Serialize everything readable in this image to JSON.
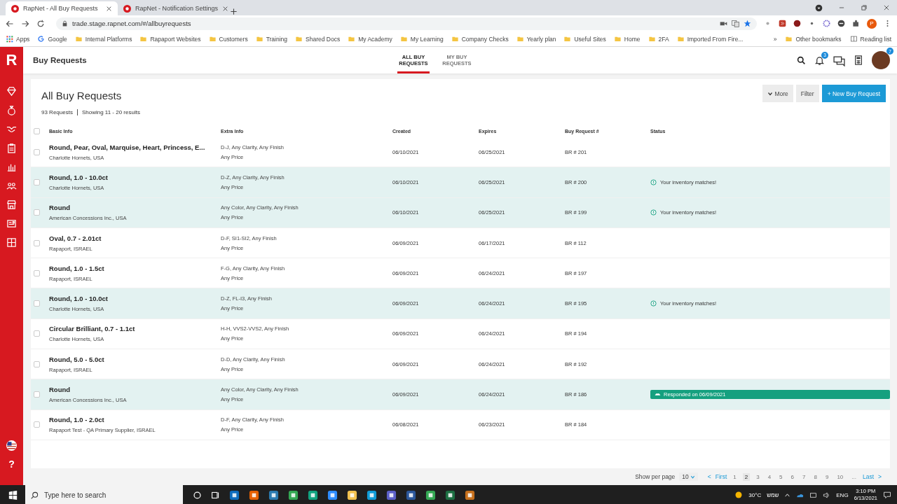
{
  "browser": {
    "tabs": [
      {
        "title": "RapNet - All Buy Requests",
        "selected": true
      },
      {
        "title": "RapNet - Notification Settings",
        "selected": false
      }
    ],
    "url": "trade.stage.rapnet.com/#/allbuyrequests",
    "profile": "P",
    "bookmarks": [
      {
        "kind": "apps",
        "label": "Apps"
      },
      {
        "kind": "google",
        "label": "Google"
      },
      {
        "kind": "folder",
        "label": "Internal Platforms"
      },
      {
        "kind": "folder",
        "label": "Rapaport Websites"
      },
      {
        "kind": "folder",
        "label": "Customers"
      },
      {
        "kind": "folder",
        "label": "Training"
      },
      {
        "kind": "folder",
        "label": "Shared Docs"
      },
      {
        "kind": "folder",
        "label": "My Academy"
      },
      {
        "kind": "folder",
        "label": "My Learning"
      },
      {
        "kind": "folder",
        "label": "Company Checks"
      },
      {
        "kind": "folder",
        "label": "Yearly plan"
      },
      {
        "kind": "folder",
        "label": "Useful Sites"
      },
      {
        "kind": "folder",
        "label": "Home"
      },
      {
        "kind": "folder",
        "label": "2FA"
      },
      {
        "kind": "folder",
        "label": "Imported From Fire..."
      }
    ],
    "overflow": "»",
    "other_bookmarks": "Other bookmarks",
    "reading_list": "Reading list"
  },
  "app": {
    "logo": "R",
    "title": "Buy Requests",
    "help": "?",
    "nav": [
      {
        "label": "ALL BUY REQUESTS",
        "selected": true
      },
      {
        "label": "MY BUY REQUESTS",
        "selected": false
      }
    ],
    "notification_count": "3",
    "avatar_badge": "7"
  },
  "page": {
    "title": "All Buy Requests",
    "count": "93 Requests",
    "showing": "Showing 11 - 20 results",
    "buttons": [
      {
        "kind": "menu",
        "label": "More"
      },
      {
        "kind": "plain",
        "label": "Filter"
      },
      {
        "kind": "primary",
        "label": "+ New Buy Request"
      }
    ]
  },
  "table": {
    "all_checked": false,
    "columns": [
      "Basic Info",
      "Extra Info",
      "Created",
      "Expires",
      "Buy Request #",
      "Status"
    ],
    "rows": [
      {
        "checked": false,
        "highlighted": false,
        "title": "Round, Pear, Oval, Marquise, Heart, Princess, E...",
        "company": "Charlotte Hornets, USA",
        "extra": "D-J, Any Clarity, Any Finish",
        "price": "Any Price",
        "created": "06/10/2021",
        "expires": "06/25/2021",
        "number": "BR # 201"
      },
      {
        "checked": false,
        "highlighted": true,
        "title": "Round, 1.0 - 10.0ct",
        "company": "Charlotte Hornets, USA",
        "extra": "D-Z, Any Clarity, Any Finish",
        "price": "Any Price",
        "created": "06/10/2021",
        "expires": "06/25/2021",
        "number": "BR # 200",
        "status": {
          "kind": "match",
          "text": "Your inventory matches!"
        }
      },
      {
        "checked": false,
        "highlighted": true,
        "title": "Round",
        "company": "American Concessions Inc., USA",
        "extra": "Any Color, Any Clarity, Any Finish",
        "price": "Any Price",
        "created": "06/10/2021",
        "expires": "06/25/2021",
        "number": "BR # 199",
        "status": {
          "kind": "match",
          "text": "Your inventory matches!"
        }
      },
      {
        "checked": false,
        "highlighted": false,
        "title": "Oval, 0.7 - 2.01ct",
        "company": "Rapaport, ISRAEL",
        "extra": "D-F, SI1-SI2, Any Finish",
        "price": "Any Price",
        "created": "06/09/2021",
        "expires": "06/17/2021",
        "number": "BR # 112"
      },
      {
        "checked": false,
        "highlighted": false,
        "title": "Round, 1.0 - 1.5ct",
        "company": "Rapaport, ISRAEL",
        "extra": "F-G, Any Clarity, Any Finish",
        "price": "Any Price",
        "created": "06/09/2021",
        "expires": "06/24/2021",
        "number": "BR # 197"
      },
      {
        "checked": false,
        "highlighted": true,
        "title": "Round, 1.0 - 10.0ct",
        "company": "Charlotte Hornets, USA",
        "extra": "D-Z, FL-I3, Any Finish",
        "price": "Any Price",
        "created": "06/09/2021",
        "expires": "06/24/2021",
        "number": "BR # 195",
        "status": {
          "kind": "match",
          "text": "Your inventory matches!"
        }
      },
      {
        "checked": false,
        "highlighted": false,
        "title": "Circular Brilliant, 0.7 - 1.1ct",
        "company": "Charlotte Hornets, USA",
        "extra": "H-H, VVS2-VVS2, Any Finish",
        "price": "Any Price",
        "created": "06/09/2021",
        "expires": "06/24/2021",
        "number": "BR # 194"
      },
      {
        "checked": false,
        "highlighted": false,
        "title": "Round, 5.0 - 5.0ct",
        "company": "Rapaport, ISRAEL",
        "extra": "D-D, Any Clarity, Any Finish",
        "price": "Any Price",
        "created": "06/09/2021",
        "expires": "06/24/2021",
        "number": "BR # 192"
      },
      {
        "checked": false,
        "highlighted": true,
        "title": "Round",
        "company": "American Concessions Inc., USA",
        "extra": "Any Color, Any Clarity, Any Finish",
        "price": "Any Price",
        "created": "06/09/2021",
        "expires": "06/24/2021",
        "number": "BR # 186",
        "status": {
          "kind": "responded",
          "text": "Responded on 06/09/2021"
        }
      },
      {
        "checked": false,
        "highlighted": false,
        "title": "Round, 1.0 - 2.0ct",
        "company": "Rapaport Test - QA Primary Supplier, ISRAEL",
        "extra": "D-F, Any Clarity, Any Finish",
        "price": "Any Price",
        "created": "06/08/2021",
        "expires": "06/23/2021",
        "number": "BR # 184"
      }
    ]
  },
  "pagination": {
    "label": "Show per page",
    "per_page": "10",
    "prev": "<",
    "first": "First",
    "pages": [
      {
        "label": "1",
        "selected": false
      },
      {
        "label": "2",
        "selected": true
      },
      {
        "label": "3",
        "selected": false
      },
      {
        "label": "4",
        "selected": false
      },
      {
        "label": "5",
        "selected": false
      },
      {
        "label": "6",
        "selected": false
      },
      {
        "label": "7",
        "selected": false
      },
      {
        "label": "8",
        "selected": false
      },
      {
        "label": "9",
        "selected": false
      },
      {
        "label": "10",
        "selected": false
      }
    ],
    "ellipsis": "...",
    "last": "Last",
    "next": ">"
  },
  "taskbar": {
    "search": "Type here to search",
    "weather": "30°C",
    "weather_text": "שמש",
    "lang": "ENG",
    "time": "3:10 PM",
    "date": "6/13/2021"
  }
}
